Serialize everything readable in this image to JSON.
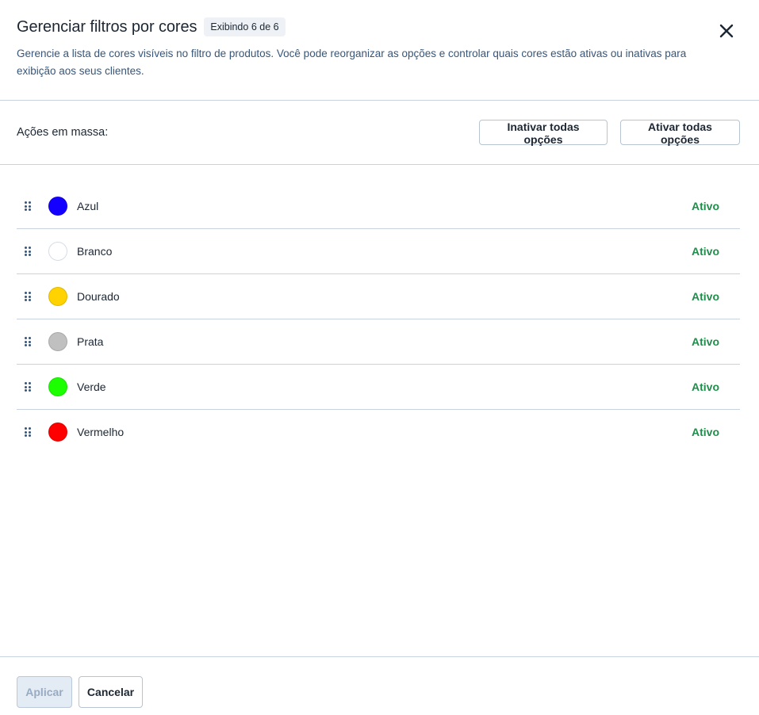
{
  "header": {
    "title": "Gerenciar filtros por cores",
    "badge": "Exibindo 6 de 6",
    "description": "Gerencie a lista de cores visíveis no filtro de produtos. Você pode reorganizar as opções e controlar quais cores estão ativas ou inativas para exibição aos seus clientes.",
    "close_icon": "close-icon"
  },
  "bulk": {
    "label": "Ações em massa:",
    "deactivate_all": "Inativar todas opções",
    "activate_all": "Ativar todas opções"
  },
  "colors": [
    {
      "name": "Azul",
      "hex": "#1400ff",
      "status": "Ativo"
    },
    {
      "name": "Branco",
      "hex": "#ffffff",
      "status": "Ativo"
    },
    {
      "name": "Dourado",
      "hex": "#ffd200",
      "status": "Ativo"
    },
    {
      "name": "Prata",
      "hex": "#c0c0c0",
      "status": "Ativo"
    },
    {
      "name": "Verde",
      "hex": "#1bff00",
      "status": "Ativo"
    },
    {
      "name": "Vermelho",
      "hex": "#ff0000",
      "status": "Ativo"
    }
  ],
  "footer": {
    "apply": "Aplicar",
    "cancel": "Cancelar"
  },
  "theme": {
    "active_status_color": "#1f8e4a",
    "border_color": "#c9d3e0",
    "text_secondary": "#37567a"
  }
}
